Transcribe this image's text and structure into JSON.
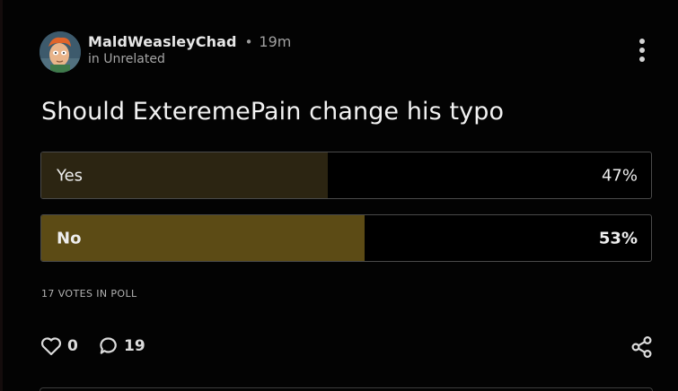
{
  "post": {
    "author": "MaldWeasleyChad",
    "separator": "•",
    "age": "19m",
    "community": "in Unrelated",
    "title": "Should ExteremePain change his typo"
  },
  "poll": {
    "options": [
      {
        "label": "Yes",
        "percent_text": "47%",
        "fraction": 0.47,
        "selected": false,
        "fill_color": "#2c2512"
      },
      {
        "label": "No",
        "percent_text": "53%",
        "fraction": 0.53,
        "selected": true,
        "fill_color": "#5c4b15"
      }
    ],
    "votes_text": "17 VOTES IN POLL"
  },
  "actions": {
    "likes": "0",
    "comments": "19"
  },
  "icons": {
    "avatar": "avatar-image",
    "menu": "kebab-menu-icon",
    "like": "heart-icon",
    "comment": "comment-bubble-icon",
    "share": "share-icon"
  },
  "colors": {
    "background": "#030303",
    "text": "#eeeeee",
    "muted": "#a6a6a6",
    "option_border": "#4a4a4a"
  }
}
